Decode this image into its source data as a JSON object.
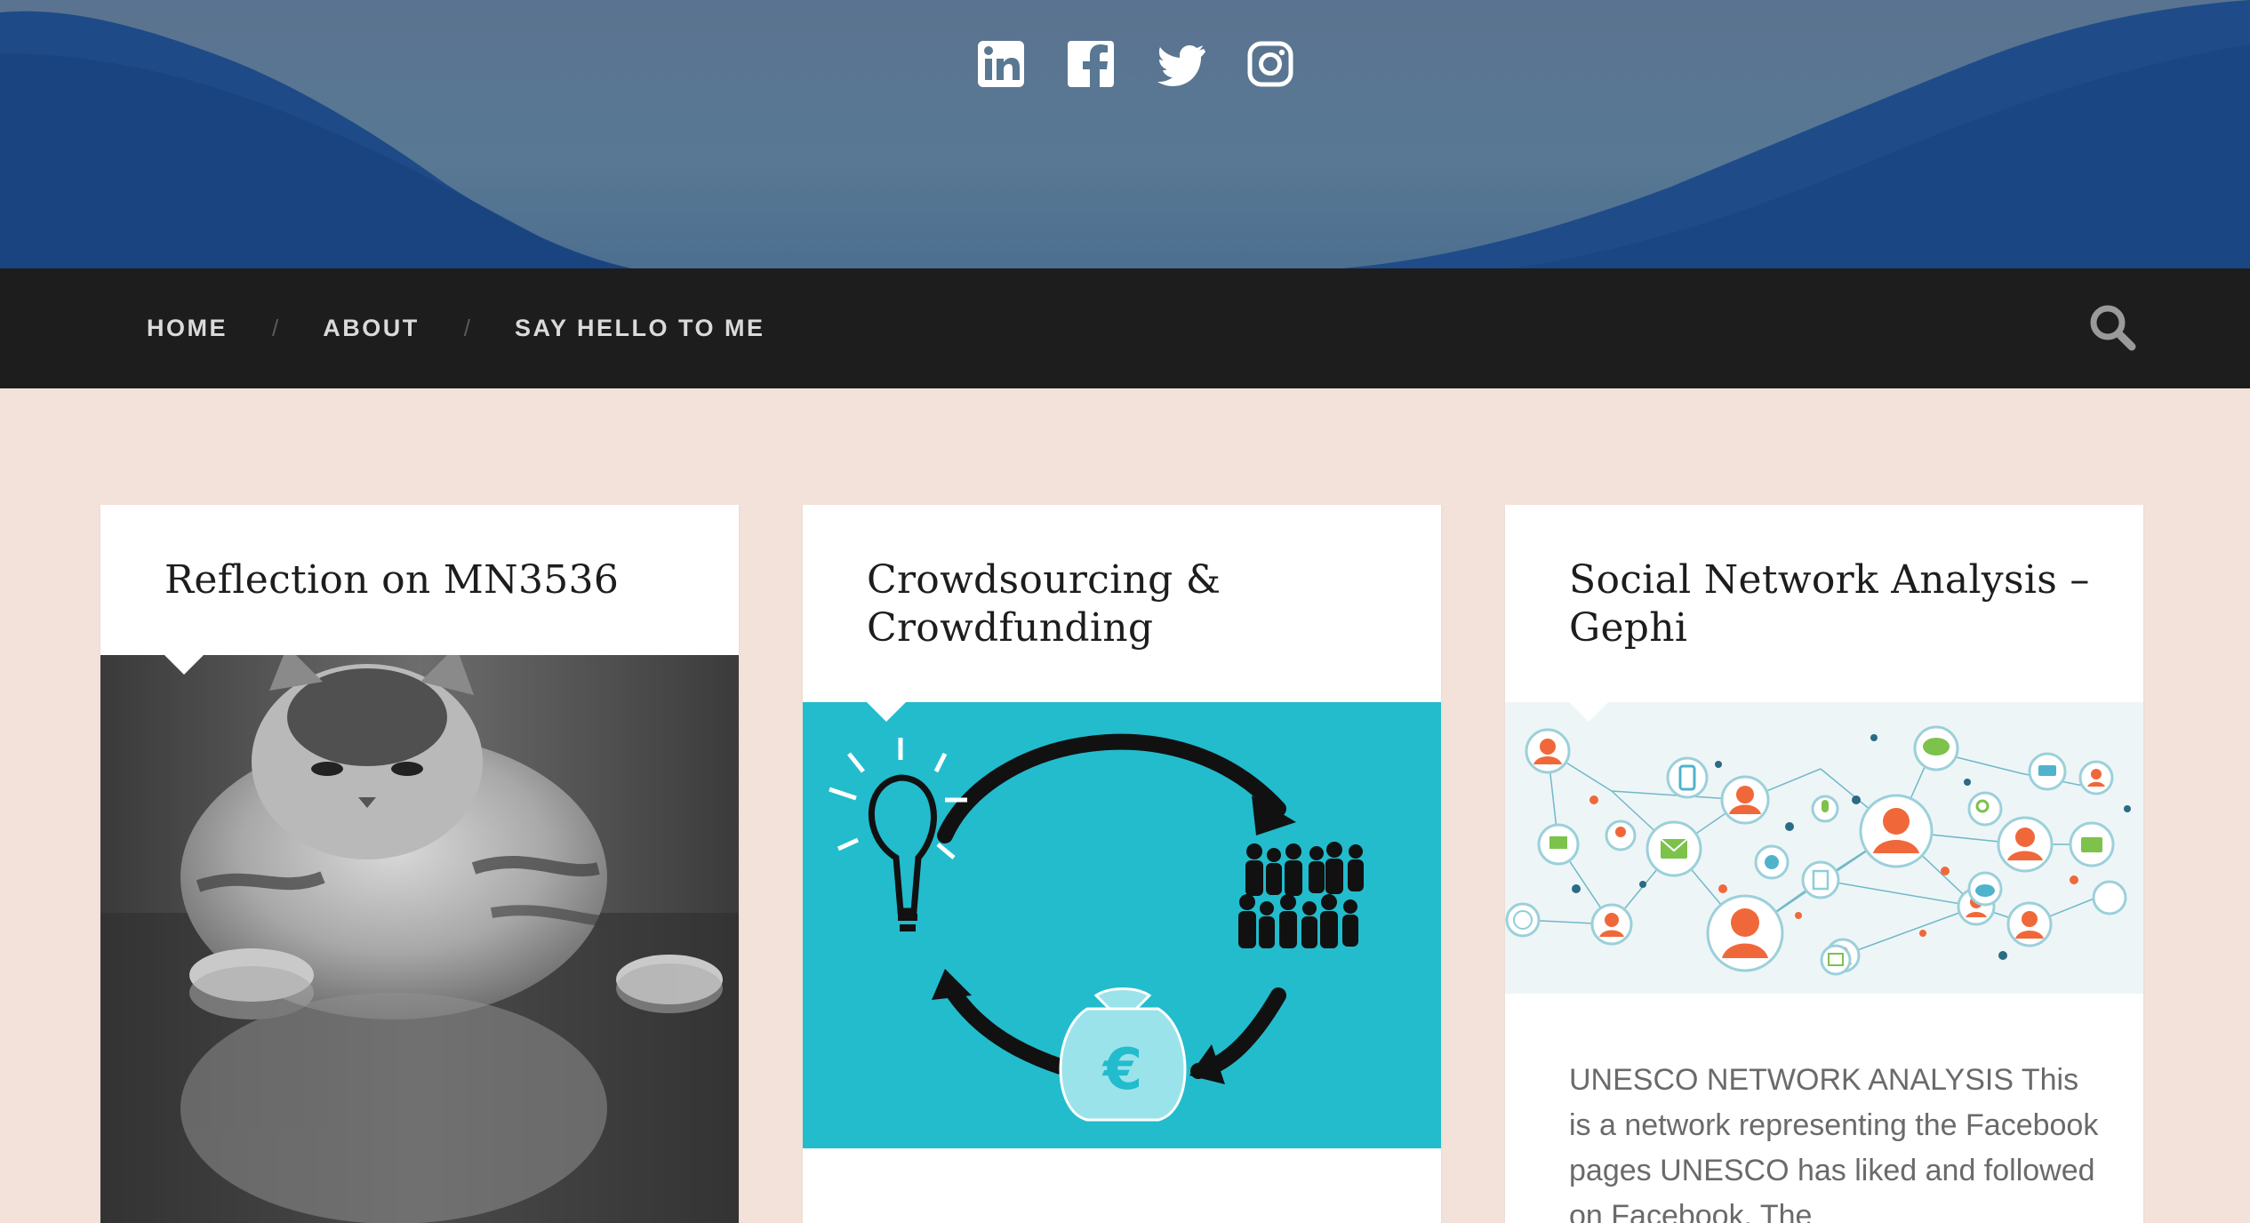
{
  "social": {
    "linkedin_icon": "linkedin-icon",
    "facebook_icon": "facebook-icon",
    "twitter_icon": "twitter-icon",
    "instagram_icon": "instagram-icon"
  },
  "nav": {
    "items": [
      {
        "label": "HOME"
      },
      {
        "label": "ABOUT"
      },
      {
        "label": "SAY HELLO TO ME"
      }
    ],
    "separator": "/",
    "search_icon": "search-icon"
  },
  "colors": {
    "page_bg": "#f3e2d9",
    "nav_bg": "#1d1d1d",
    "crowd_bg": "#22bccd"
  },
  "posts": [
    {
      "title": "Reflection on MN3536",
      "image": "kitten-reflection-image"
    },
    {
      "title": "Crowdsourcing & Crowdfunding",
      "image": "crowdfunding-cycle-image"
    },
    {
      "title": "Social Network Analysis –  Gephi",
      "image": "social-network-graph-image",
      "excerpt": "UNESCO NETWORK ANALYSIS This is a network representing the Facebook pages UNESCO has liked and followed on Facebook. The"
    }
  ]
}
